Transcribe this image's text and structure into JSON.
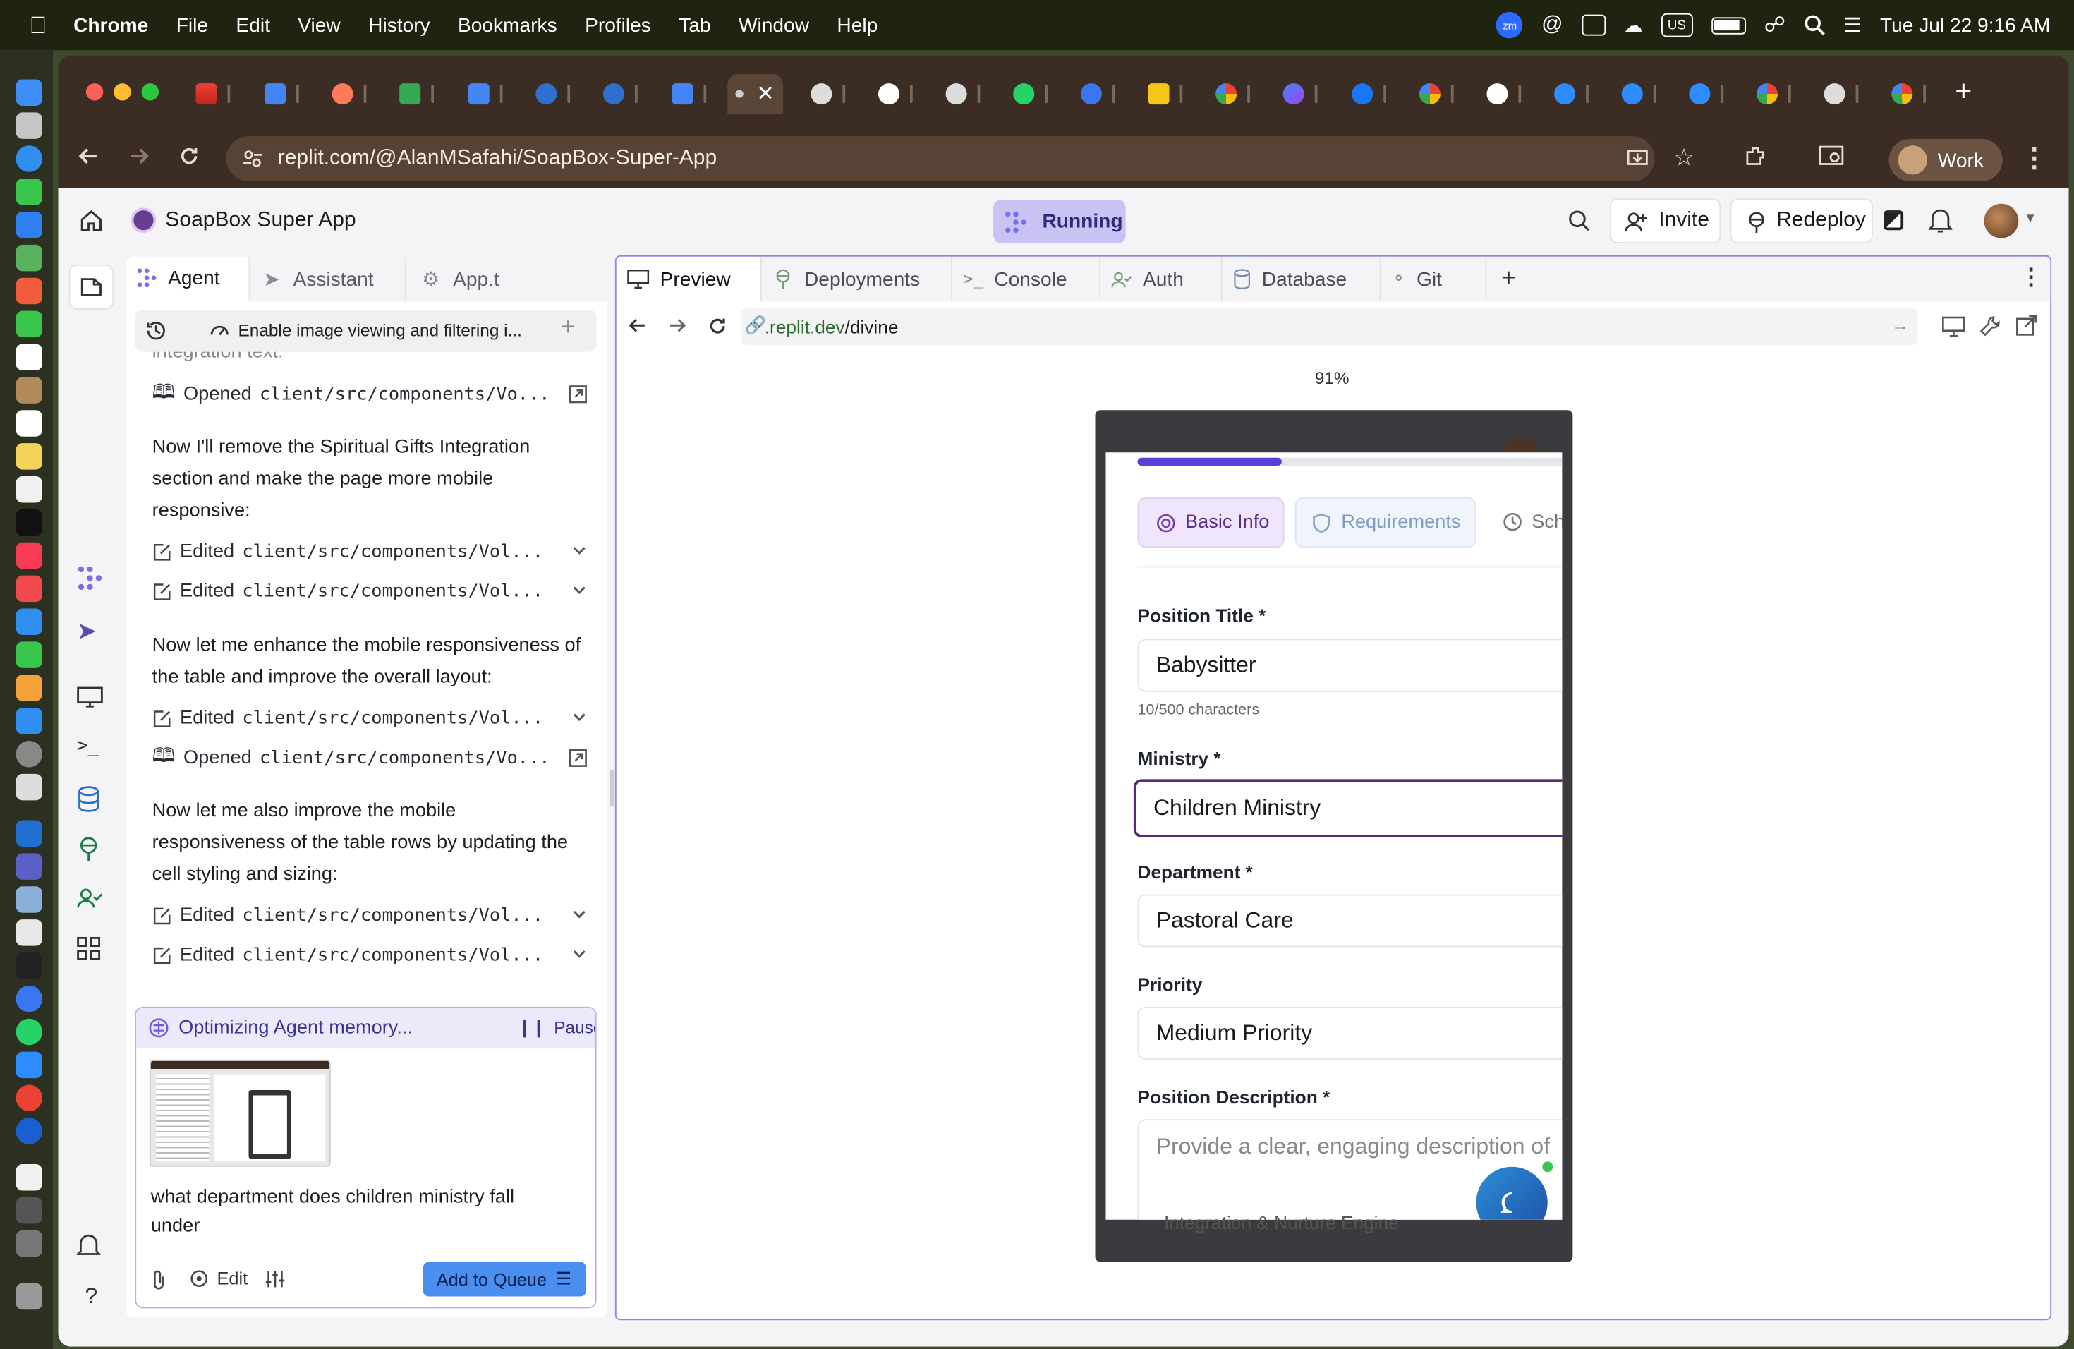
{
  "menubar": {
    "app_name": "Chrome",
    "items": [
      "File",
      "Edit",
      "View",
      "History",
      "Bookmarks",
      "Profiles",
      "Tab",
      "Window",
      "Help"
    ],
    "keyboard": "US",
    "datetime": "Tue Jul 22  9:16 AM"
  },
  "browser": {
    "url": "replit.com/@AlanMSafahi/SoapBox-Super-App",
    "profile_label": "Work",
    "new_tab": "+"
  },
  "app": {
    "project_name": "SoapBox Super App",
    "status": "Running",
    "invite_label": "Invite",
    "redeploy_label": "Redeploy"
  },
  "agent_panel": {
    "tabs": [
      "Agent",
      "Assistant",
      "App.t"
    ],
    "history_title": "Enable image viewing and filtering i...",
    "cut_text": "integration text.",
    "messages": [
      {
        "type": "file",
        "action": "Opened",
        "path": "client/src/components/Vo..."
      },
      {
        "type": "text",
        "text": "Now I'll remove the Spiritual Gifts Integration section and make the page more mobile responsive:"
      },
      {
        "type": "file",
        "action": "Edited",
        "path": "client/src/components/Vol..."
      },
      {
        "type": "file",
        "action": "Edited",
        "path": "client/src/components/Vol..."
      },
      {
        "type": "text",
        "text": "Now let me enhance the mobile responsiveness of the table and improve the overall layout:"
      },
      {
        "type": "file",
        "action": "Edited",
        "path": "client/src/components/Vol..."
      },
      {
        "type": "file",
        "action": "Opened",
        "path": "client/src/components/Vo..."
      },
      {
        "type": "text",
        "text": "Now let me also improve the mobile responsiveness of the table rows by updating the cell styling and sizing:"
      },
      {
        "type": "file",
        "action": "Edited",
        "path": "client/src/components/Vol..."
      },
      {
        "type": "file",
        "action": "Edited",
        "path": "client/src/components/Vol..."
      }
    ],
    "memory_status": "Optimizing Agent memory...",
    "pause_label": "Pause",
    "input_text": "what department does children ministry fall under",
    "edit_label": "Edit",
    "queue_label": "Add to Queue"
  },
  "preview": {
    "tabs": [
      "Preview",
      "Deployments",
      "Console",
      "Auth",
      "Database",
      "Git"
    ],
    "url_prefix": ".replit.dev",
    "url_path": "/divine",
    "zoom": "91%",
    "progress": 0.33,
    "form": {
      "steps": [
        "Basic Info",
        "Requirements",
        "Sch"
      ],
      "position_title_label": "Position Title *",
      "position_title_value": "Babysitter",
      "char_count": "10/500 characters",
      "ministry_label": "Ministry *",
      "ministry_value": "Children Ministry",
      "department_label": "Department *",
      "department_value": "Pastoral Care",
      "priority_label": "Priority",
      "priority_value": "Medium Priority",
      "description_label": "Position Description *",
      "description_placeholder": "Provide a clear, engaging description of",
      "footer_text": "Integration & Nurture Engine"
    }
  },
  "colors": {
    "accent": "#6c5ce7",
    "running_bg": "#c9c3f3",
    "progress": "#5b3fd6",
    "ministry_border": "#5a2a78",
    "browser_chrome": "#3b2d24"
  }
}
